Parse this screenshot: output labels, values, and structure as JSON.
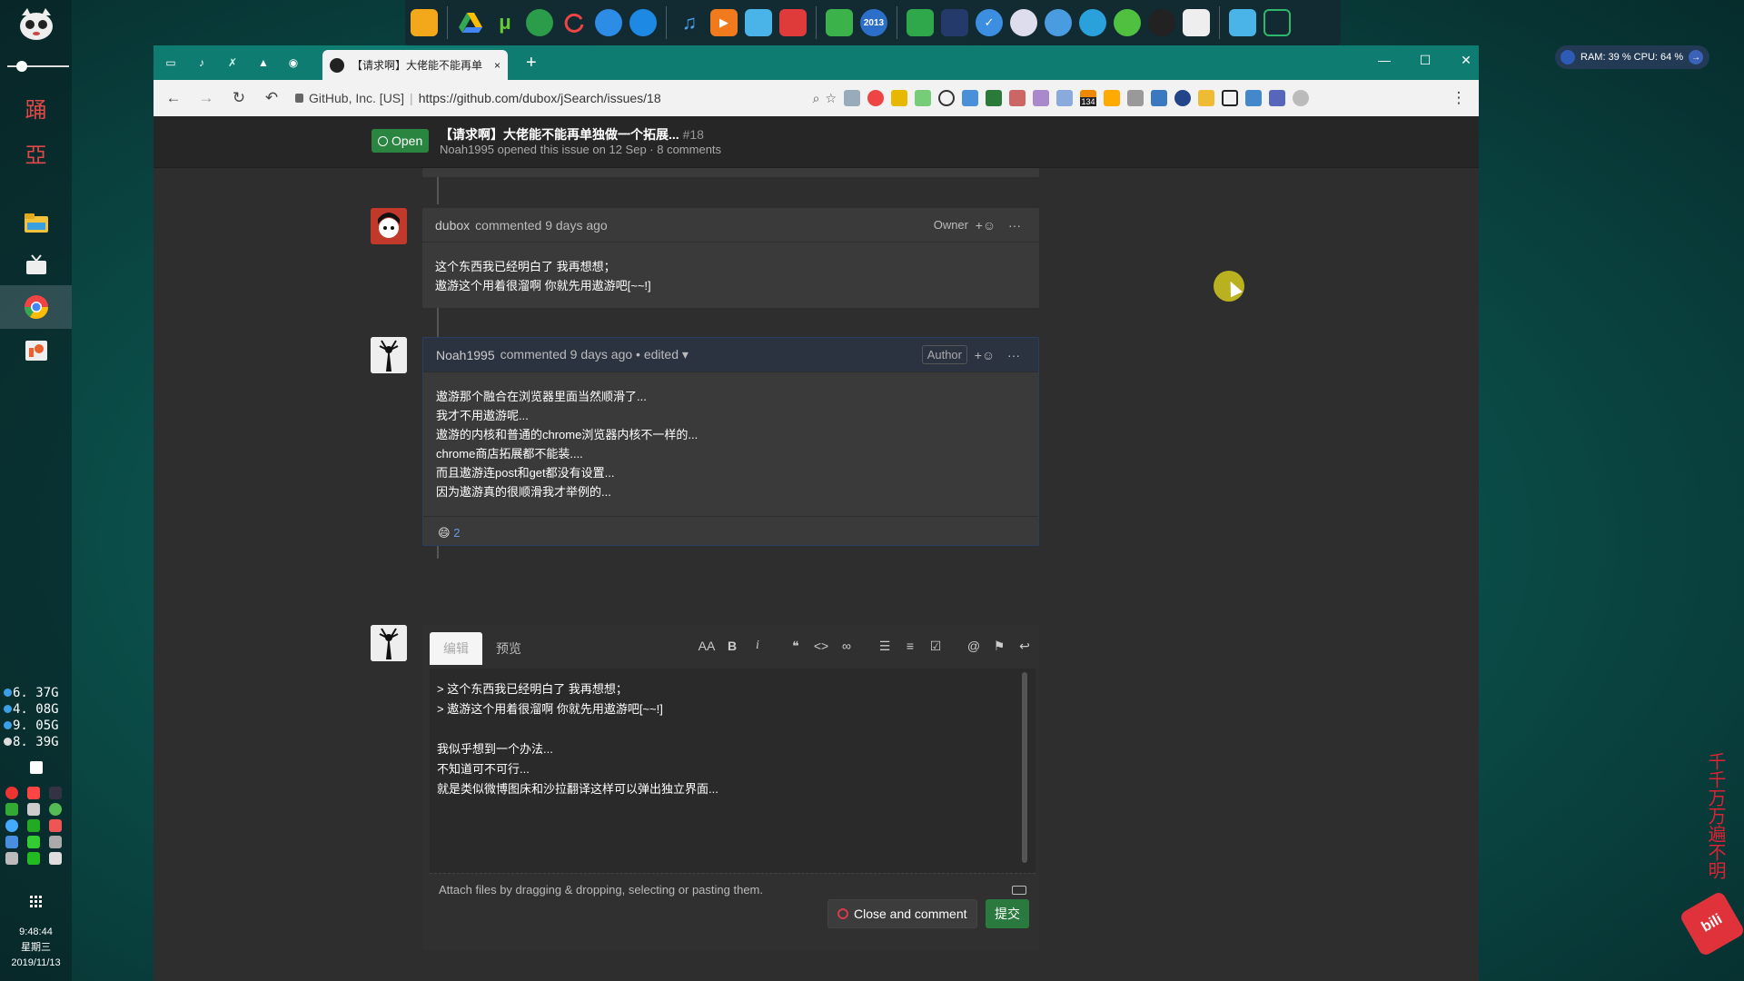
{
  "desktop": {
    "left_dock": {
      "glyph_a": "踊",
      "glyph_b": "亞",
      "stats": [
        "6. 37G",
        "4. 08G",
        "9. 05G",
        "8. 39G"
      ],
      "clock_time": "9:48:44",
      "clock_day": "星期三",
      "clock_date": "2019/11/13"
    },
    "top_dock": {
      "badge_2013": "2013"
    },
    "sysmon": {
      "text": "RAM: 39 %  CPU: 64 %"
    },
    "vertical_text": "千千万万遍不明"
  },
  "browser": {
    "tab": {
      "title": "【请求啊】大佬能不能再单",
      "close": "×"
    },
    "new_tab": "+",
    "window_controls": {
      "minimize": "—",
      "maximize": "☐",
      "close": "✕"
    },
    "omnibox": {
      "site": "GitHub, Inc. [US]",
      "url": "https://github.com/dubox/jSearch/issues/18"
    },
    "ext_badge": "134"
  },
  "issue": {
    "state": "Open",
    "title": "【请求啊】大佬能不能再单独做一个拓展...",
    "number": "#18",
    "meta": "Noah1995 opened this issue on 12 Sep · 8 comments"
  },
  "comments": [
    {
      "author": "dubox",
      "action": "commented 9 days ago",
      "role": "Owner",
      "body": "这个东西我已经明白了 我再想想；\n遨游这个用着很溜啊 你就先用遨游吧[~~!]"
    },
    {
      "author": "Noah1995",
      "action": "commented 9 days ago • edited ▾",
      "role": "Author",
      "body": "遨游那个融合在浏览器里面当然顺滑了...\n我才不用遨游呢...\n遨游的内核和普通的chrome浏览器内核不一样的...\nchrome商店拓展都不能装....\n而且遨游连post和get都没有设置...\n因为遨游真的很顺滑我才举例的...",
      "reaction_emoji": "😄",
      "reaction_count": "2"
    }
  ],
  "editor": {
    "tab_write": "编辑",
    "tab_preview": "预览",
    "text": "> 这个东西我已经明白了 我再想想；\n> 遨游这个用着很溜啊 你就先用遨游吧[~~!]\n\n我似乎想到一个办法...\n不知道可不可行...\n就是类似微博图床和沙拉翻译这样可以弹出独立界面...",
    "attach_hint": "Attach files by dragging & dropping, selecting or pasting them.",
    "close_comment": "Close and comment",
    "submit": "提交"
  }
}
